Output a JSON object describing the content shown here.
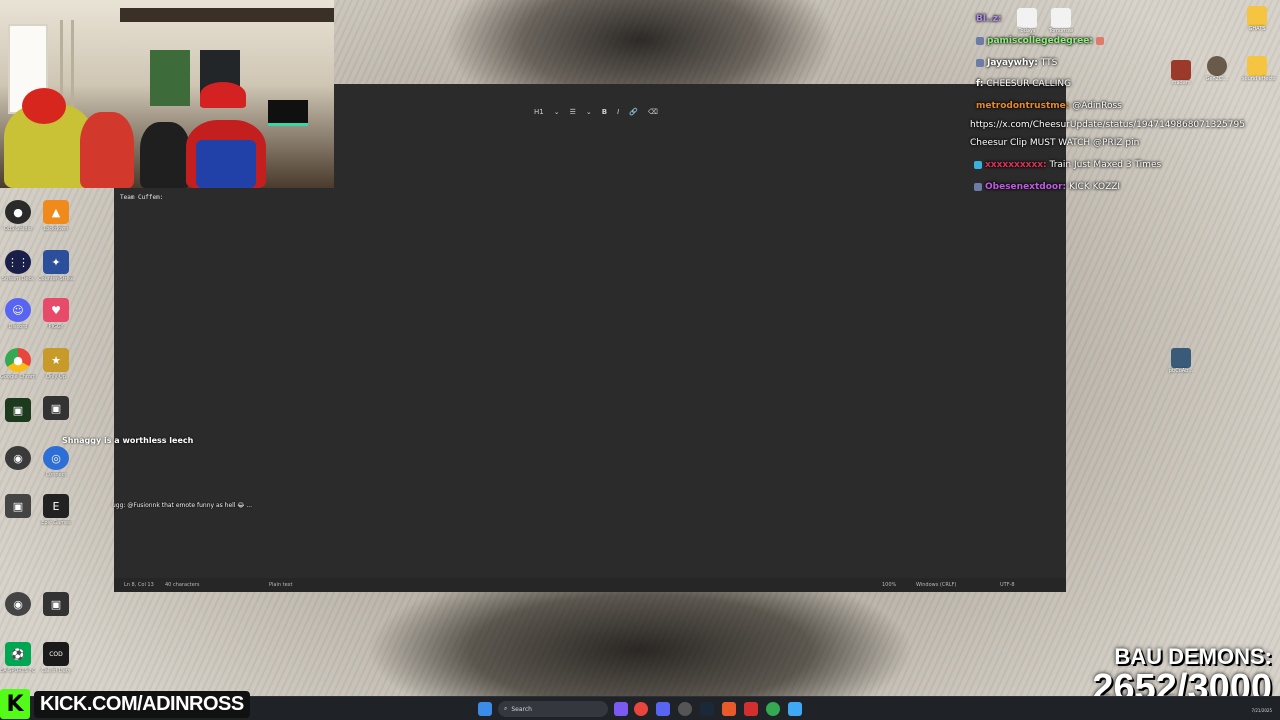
{
  "stream": {
    "kick_url": "KICK.COM/ADINROSS",
    "goal_title": "BAU DEMONS:",
    "goal_count": "2652/3000",
    "goal_progress_percent": 88.4
  },
  "notepad": {
    "toolbar": {
      "heading": "H1",
      "list": "☰",
      "bold": "B",
      "italic": "I",
      "link": "🔗",
      "clear": "⌫"
    },
    "text": "Team Cuffem:",
    "status": {
      "position": "Ln 8, Col 13",
      "characters": "40 characters",
      "format": "Plain text",
      "zoom": "100%",
      "line_endings": "Windows (CRLF)",
      "encoding": "UTF-8"
    }
  },
  "chat": [
    {
      "user": "Bl..z:",
      "message": "",
      "color": "#b28cf0"
    },
    {
      "user": "pamiscollegedegree:",
      "message": "",
      "color": "#8ef07a"
    },
    {
      "user": "Jayaywhy:",
      "message": "TTS",
      "color": "#ffffff"
    },
    {
      "user": "f:",
      "message": "CHEESUR CALLING",
      "color": "#ffffff"
    },
    {
      "user": "metrodontrustme:",
      "message": "@AdinRoss",
      "color": "#e48a2a"
    },
    {
      "user": "",
      "message": "https://x.com/CheesurUpdate/status/1947149868071325795",
      "color": "#ffffff"
    },
    {
      "user": "",
      "message": "Cheesur Clip MUST WATCH @PRIZ pin",
      "color": "#ffffff"
    },
    {
      "user": "",
      "message": "Train Just Maxed 3 Times",
      "color": "#e0305a"
    },
    {
      "user": "Obesenextdoor:",
      "message": "KICK KOZZI",
      "color": "#c05ae6"
    }
  ],
  "left_chat": [
    {
      "text": "Shnaggy is a worthless leech"
    },
    {
      "text": "ugg: @Fusionnk that emote funny as hell 😂 ..."
    }
  ],
  "desktop_icons": [
    {
      "label": "OBS Studio",
      "icon": "obs-icon",
      "color": "#2a2a2a"
    },
    {
      "label": "Lockdown",
      "icon": "vlc-icon",
      "color": "#f08a1c"
    },
    {
      "label": "Stream Deck",
      "icon": "grid-icon",
      "color": "#1a1f4a"
    },
    {
      "label": "Counter-Strike",
      "icon": "cs-icon",
      "color": "#2b4f9a"
    },
    {
      "label": "Discord",
      "icon": "discord-icon",
      "color": "#5865f2"
    },
    {
      "label": "PIGGY",
      "icon": "pig-icon",
      "color": "#e84b6a"
    },
    {
      "label": "Google Chrome",
      "icon": "chrome-icon",
      "color": "#e8453c"
    },
    {
      "label": "Only Up",
      "icon": "game-icon",
      "color": "#c79a2a"
    },
    {
      "label": "",
      "icon": "app-icon",
      "color": "#1e3a1e"
    },
    {
      "label": "",
      "icon": "app-icon",
      "color": "#333333"
    },
    {
      "label": "Connect",
      "icon": "circle-icon",
      "color": "#2d6fd6"
    },
    {
      "label": "",
      "icon": "app-icon",
      "color": "#3a3a3a"
    },
    {
      "label": "Epic Games",
      "icon": "epic-icon",
      "color": "#222222"
    },
    {
      "label": "",
      "icon": "app-icon",
      "color": "#444444"
    },
    {
      "label": "EA SPORTS FC 25",
      "icon": "fc-icon",
      "color": "#00a651"
    },
    {
      "label": "Call of Duty",
      "icon": "cod-icon",
      "color": "#1a1a1a"
    }
  ],
  "top_right_icons": [
    {
      "label": "Todays",
      "icon": "file-icon"
    },
    {
      "label": "Tomorrow",
      "icon": "file-icon"
    },
    {
      "label": "GHATS",
      "icon": "folder-icon"
    },
    {
      "label": "rnadam",
      "icon": "image-icon"
    },
    {
      "label": "Gen2Cl...",
      "icon": "person-icon"
    },
    {
      "label": "sound effects",
      "icon": "folder-icon"
    },
    {
      "label": "pbCoAb...",
      "icon": "person-icon"
    }
  ],
  "taskbar": {
    "search_placeholder": "Search",
    "date": "7/21/2025"
  },
  "colors": {
    "kick_green": "#53fc18",
    "editor_bg": "#2b2b2b",
    "taskbar_bg": "#1f2226"
  }
}
